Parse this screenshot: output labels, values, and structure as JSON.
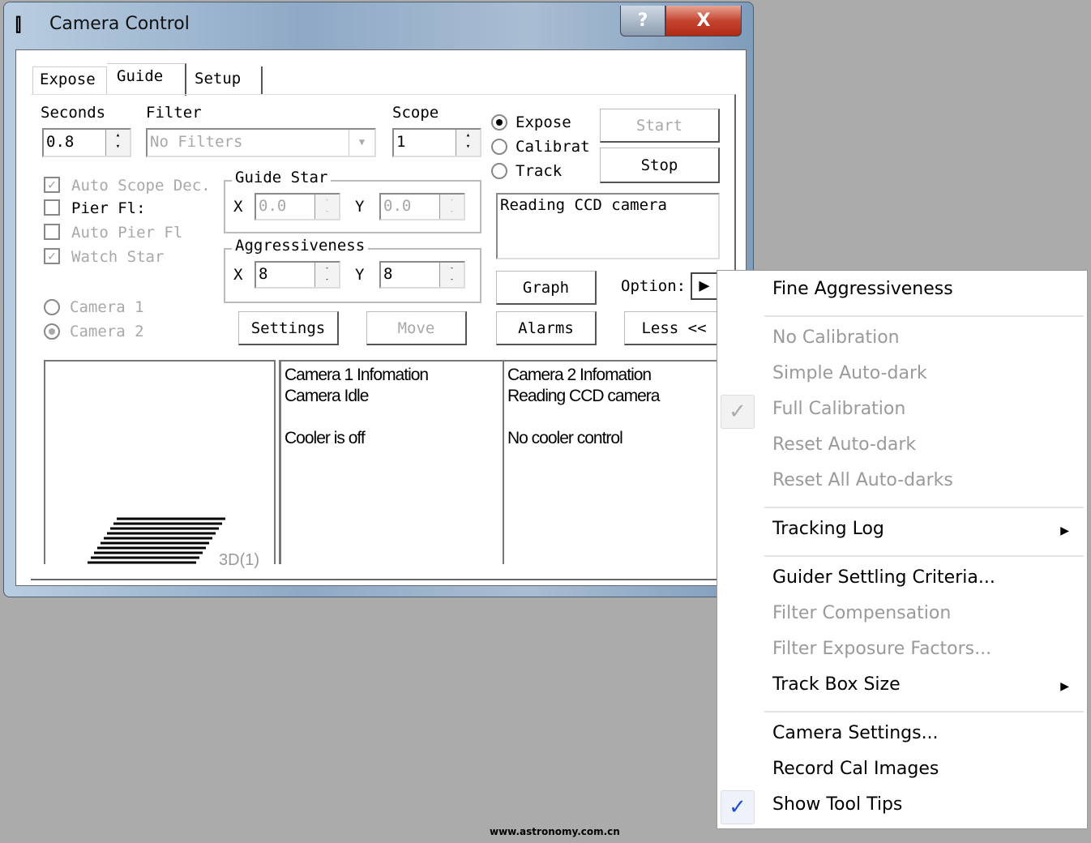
{
  "window": {
    "title": "Camera Control",
    "help_label": "?",
    "close_label": "X"
  },
  "tabs": [
    {
      "label": "Expose"
    },
    {
      "label": "Guide"
    },
    {
      "label": "Setup"
    }
  ],
  "guide": {
    "seconds_label": "Seconds",
    "seconds_value": "0.8",
    "filter_label": "Filter",
    "filter_value": "No Filters",
    "scope_label": "Scope",
    "scope_value": "1",
    "modes": [
      {
        "label": "Expose",
        "selected": true
      },
      {
        "label": "Calibrat",
        "selected": false
      },
      {
        "label": "Track",
        "selected": false
      }
    ],
    "start_label": "Start",
    "stop_label": "Stop",
    "status_text": "Reading CCD camera",
    "checks": [
      {
        "label": "Auto Scope Dec.",
        "checked": true,
        "enabled": false
      },
      {
        "label": "Pier Fl:",
        "checked": false,
        "enabled": true
      },
      {
        "label": "Auto Pier Fl",
        "checked": false,
        "enabled": false
      },
      {
        "label": "Watch Star",
        "checked": true,
        "enabled": false
      }
    ],
    "guide_star": {
      "label": "Guide Star",
      "x_label": "X",
      "x_value": "0.0",
      "y_label": "Y",
      "y_value": "0.0"
    },
    "aggressiveness": {
      "label": "Aggressiveness",
      "x_label": "X",
      "x_value": "8",
      "y_label": "Y",
      "y_value": "8"
    },
    "cameras": [
      {
        "label": "Camera 1",
        "selected": false
      },
      {
        "label": "Camera 2",
        "selected": true
      }
    ],
    "settings_label": "Settings",
    "move_label": "Move",
    "graph_label": "Graph",
    "alarms_label": "Alarms",
    "options_label": "Option:",
    "less_label": "Less <<",
    "preview_label": "3D(1)",
    "camera1_info": "Camera 1 Infomation\nCamera Idle\n\nCooler is off",
    "camera2_info": "Camera 2 Infomation\nReading CCD camera\n\nNo cooler control"
  },
  "menu": {
    "items": [
      {
        "label": "Fine Aggressiveness",
        "enabled": true
      },
      {
        "label": "No Calibration",
        "enabled": false
      },
      {
        "label": "Simple Auto-dark",
        "enabled": false
      },
      {
        "label": "Full Calibration",
        "enabled": false,
        "checked": true
      },
      {
        "label": "Reset Auto-dark",
        "enabled": false
      },
      {
        "label": "Reset All Auto-darks",
        "enabled": false
      },
      {
        "label": "Tracking Log",
        "enabled": true,
        "submenu": true
      },
      {
        "label": "Guider Settling Criteria...",
        "enabled": true
      },
      {
        "label": "Filter Compensation",
        "enabled": false
      },
      {
        "label": "Filter Exposure Factors...",
        "enabled": false
      },
      {
        "label": "Track Box Size",
        "enabled": true,
        "submenu": true
      },
      {
        "label": "Camera Settings...",
        "enabled": true
      },
      {
        "label": "Record Cal Images",
        "enabled": true
      },
      {
        "label": "Show Tool Tips",
        "enabled": true,
        "checked": true
      }
    ]
  },
  "watermark": "www.astronomy.com.cn",
  "colors": {
    "check_blue": "#1a4fd6",
    "background": "#ababab"
  }
}
